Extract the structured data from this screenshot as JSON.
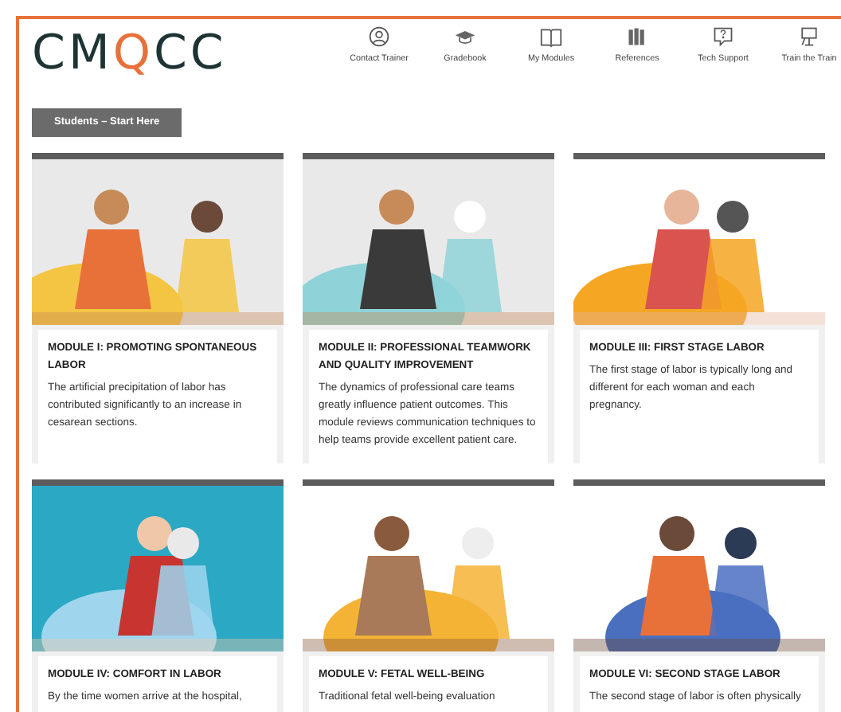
{
  "logo": [
    {
      "text": "CM",
      "accent": false
    },
    {
      "text": "Q",
      "accent": true
    },
    {
      "text": "CC",
      "accent": false
    }
  ],
  "nav": [
    {
      "label": "Contact Trainer",
      "kind": "person"
    },
    {
      "label": "Gradebook",
      "kind": "cap"
    },
    {
      "label": "My Modules",
      "kind": "book"
    },
    {
      "label": "References",
      "kind": "books"
    },
    {
      "label": "Tech Support",
      "kind": "help"
    },
    {
      "label": "Train the Train",
      "kind": "board"
    }
  ],
  "start_button": "Students – Start Here",
  "modules": [
    {
      "title": "MODULE I: PROMOTING SPONTANEOUS LABOR",
      "text": "The artificial precipitation of labor has contributed significantly to an increase in cesarean sections.",
      "kind": "picture"
    },
    {
      "title": "MODULE II: PROFESSIONAL TEAMWORK AND QUALITY IMPROVEMENT",
      "text": "The dynamics of professional care teams greatly influence patient outcomes. This module reviews communication techniques to help teams provide excellent patient care.",
      "kind": "picture"
    },
    {
      "title": "MODULE III: FIRST STAGE LABOR",
      "text": "The first stage of labor is typically long and different for each woman and each pregnancy.",
      "kind": "picture"
    },
    {
      "title": "MODULE IV: COMFORT IN LABOR",
      "text": "By the time women arrive at the hospital,",
      "kind": "picture"
    },
    {
      "title": "MODULE V: FETAL WELL-BEING",
      "text": "Traditional fetal well-being evaluation",
      "kind": "picture"
    },
    {
      "title": "MODULE VI: SECOND STAGE LABOR",
      "text": "The second stage of labor is often physically",
      "kind": "picture"
    }
  ]
}
